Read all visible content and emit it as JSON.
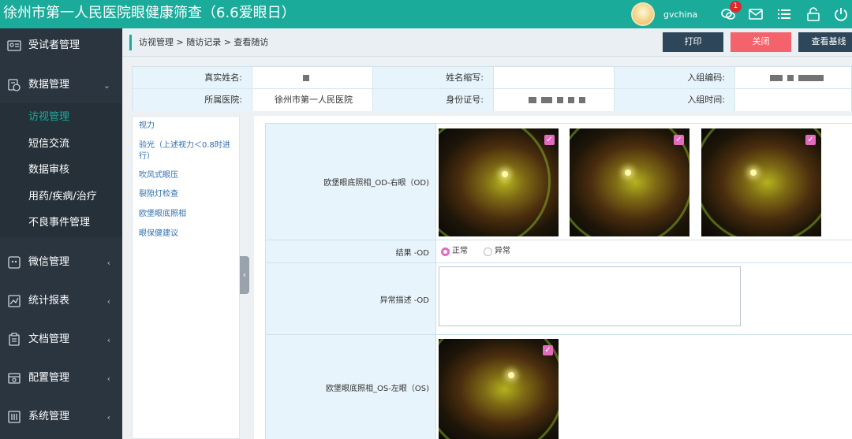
{
  "header": {
    "title": "徐州市第一人民医院眼健康筛查（6.6爱眼日）",
    "username": "gvchina",
    "notification_count": "1"
  },
  "sidebar": {
    "items": [
      {
        "label": "受试者管理",
        "icon": "user-card-icon"
      },
      {
        "label": "数据管理",
        "icon": "data-icon"
      },
      {
        "label": "微信管理",
        "icon": "wechat-icon"
      },
      {
        "label": "统计报表",
        "icon": "chart-icon"
      },
      {
        "label": "文档管理",
        "icon": "document-icon"
      },
      {
        "label": "配置管理",
        "icon": "config-icon"
      },
      {
        "label": "系统管理",
        "icon": "system-icon"
      }
    ],
    "subitems": [
      "访视管理",
      "短信交流",
      "数据审核",
      "用药/疾病/治疗",
      "不良事件管理"
    ],
    "active_sub": "访视管理"
  },
  "breadcrumb": "访视管理 > 随访记录 > 查看随访",
  "buttons": {
    "print": "打印",
    "close": "关闭",
    "baseline": "查看基线"
  },
  "info": {
    "real_name_label": "真实姓名:",
    "abbr_label": "姓名缩写:",
    "group_code_label": "入组编码:",
    "hospital_label": "所属医院:",
    "hospital": "徐州市第一人民医院",
    "id_label": "身份证号:",
    "group_time_label": "入组时间:"
  },
  "left_nav": [
    "视力",
    "验光（上述视力＜0.8时进行）",
    "吹风式眼压",
    "裂隙灯检查",
    "欧堡眼底照相",
    "眼保健建议"
  ],
  "form": {
    "od_photo_label": "欧堡眼底照相_OD-右眼（OD)",
    "result_od_label": "结果 -OD",
    "normal": "正常",
    "abnormal": "异常",
    "result_od_value": "正常",
    "abnormal_desc_od_label": "异常描述 -OD",
    "abnormal_desc_od_value": "",
    "os_photo_label": "欧堡眼底照相_OS-左眼（OS)"
  },
  "colors": {
    "header": "#1aab9b",
    "sidebar": "#2a3540",
    "print_button": "#2d4659",
    "close_button": "#f4626b",
    "baseline_button": "#2d4659",
    "checkbox": "#e36bbd"
  }
}
